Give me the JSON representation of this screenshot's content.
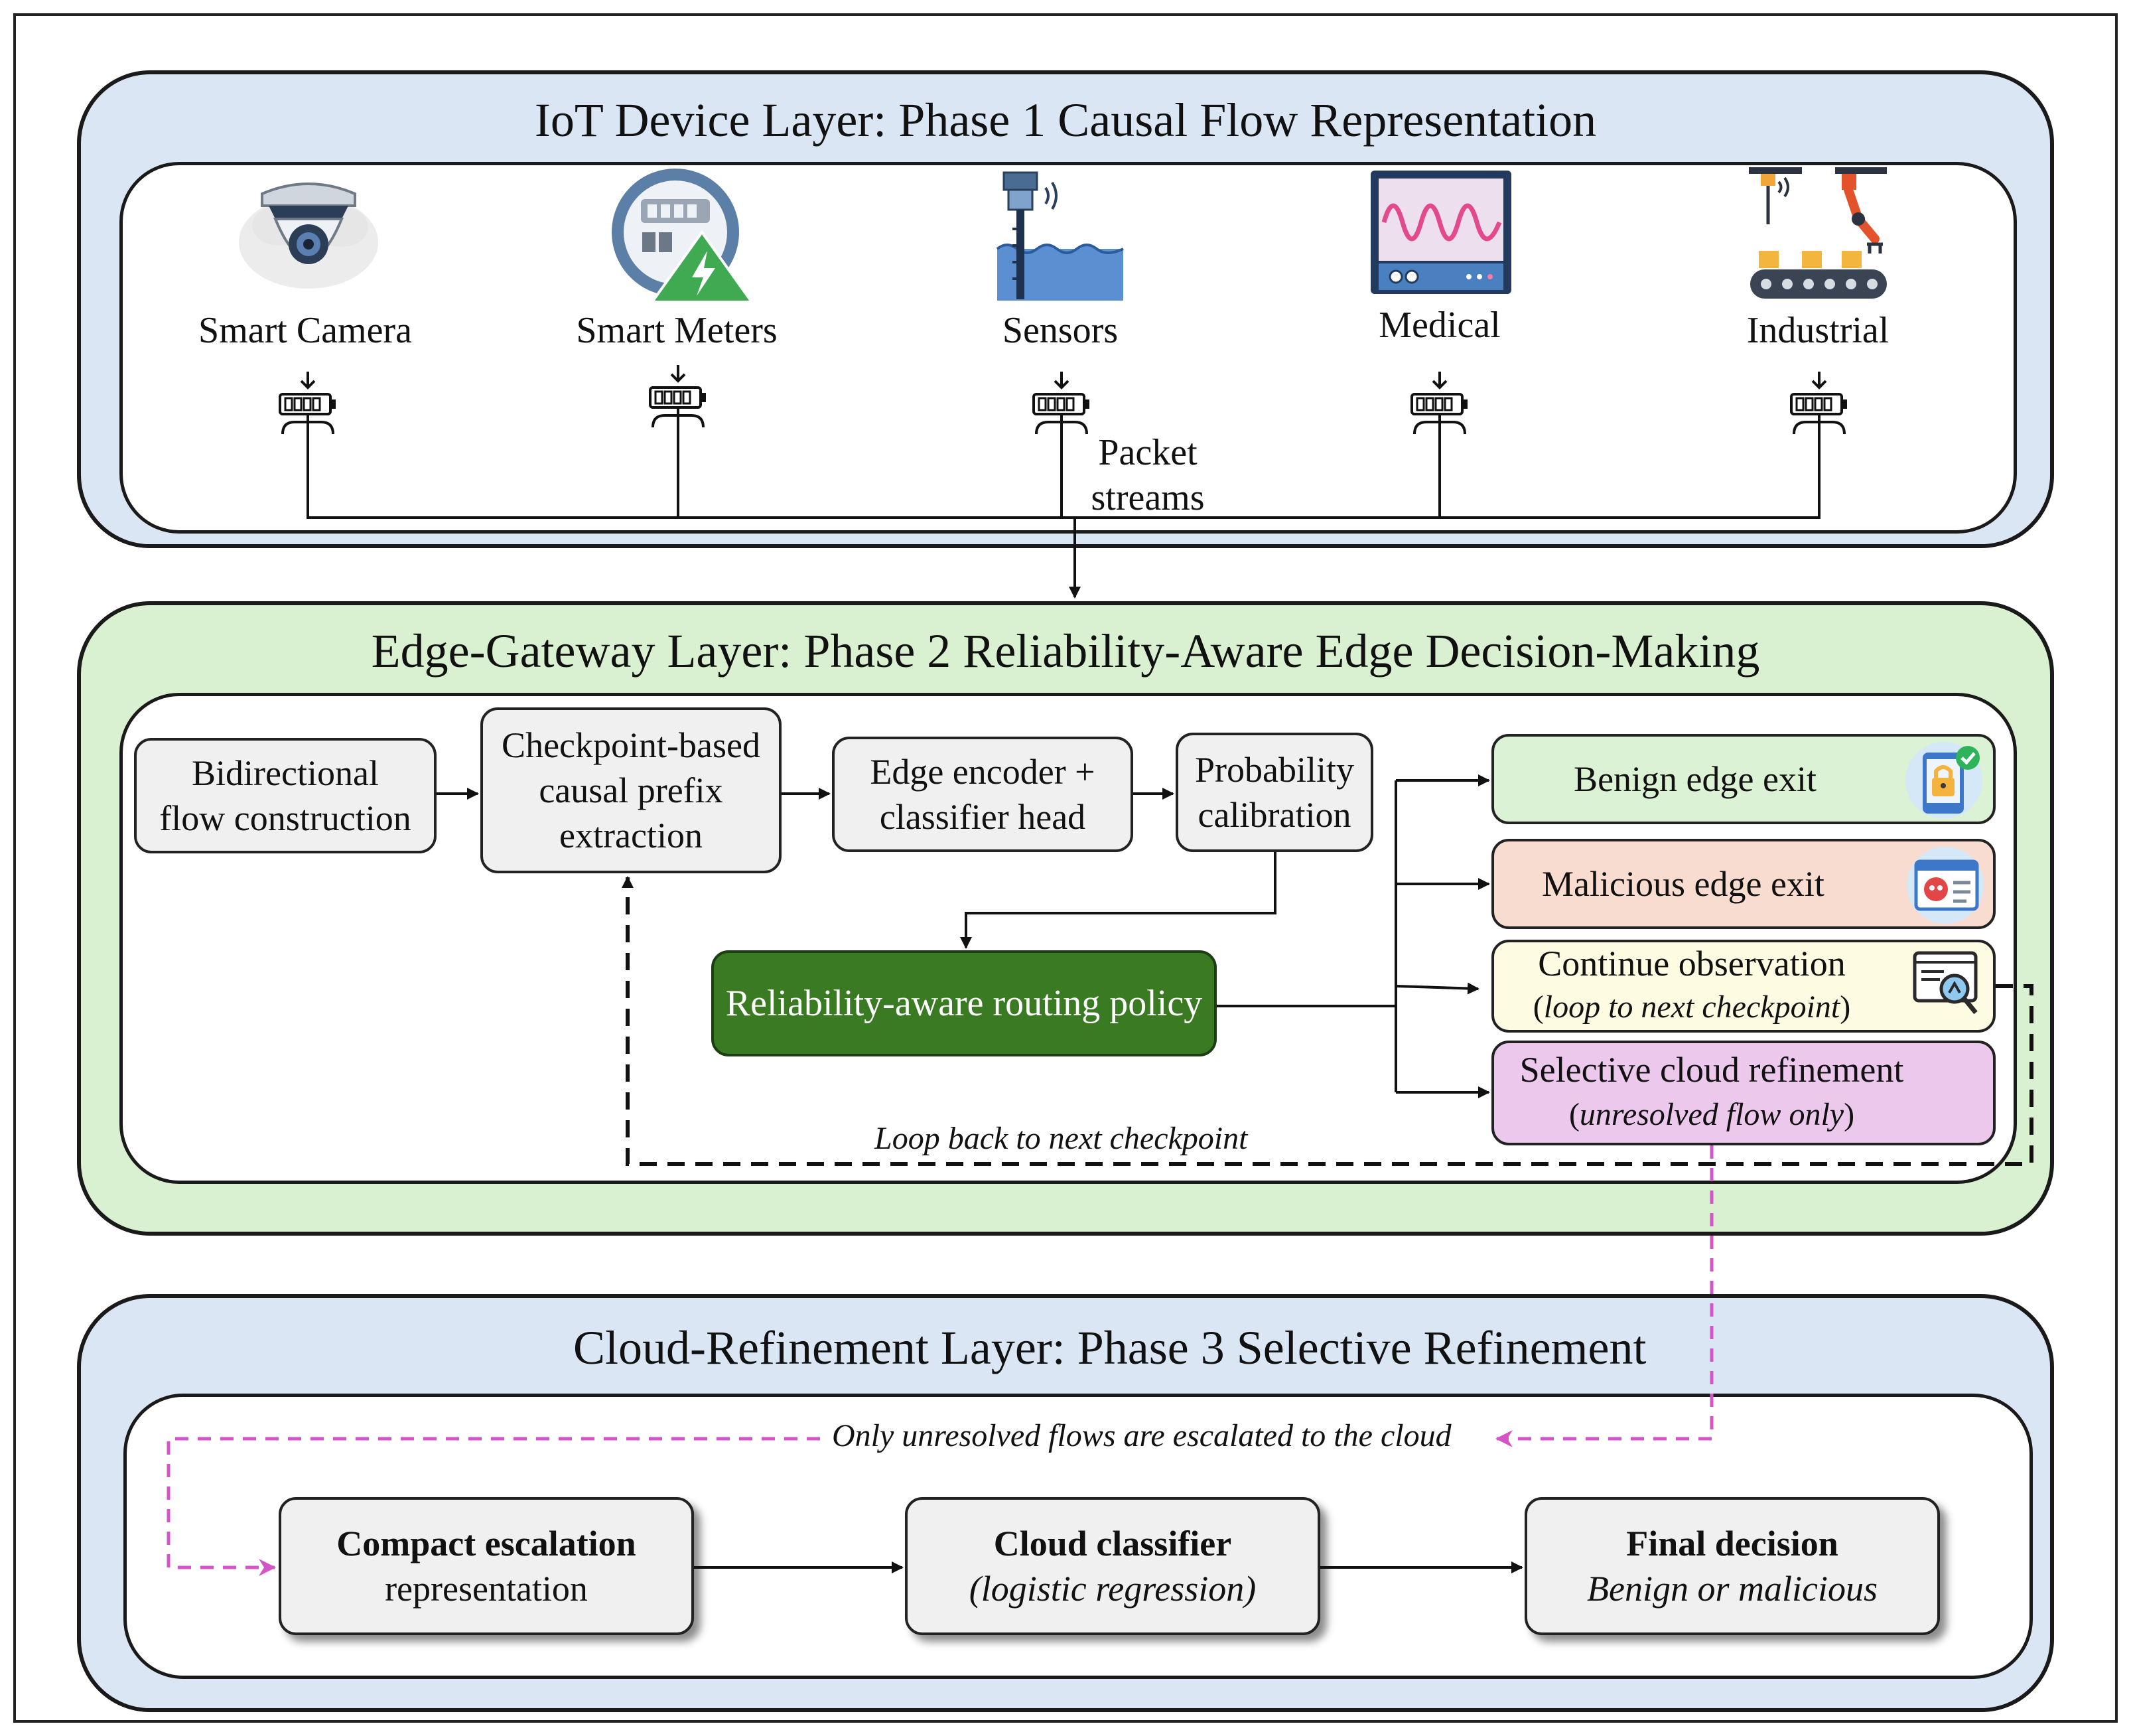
{
  "layer1": {
    "title": "IoT Device Layer: Phase 1 Causal Flow Representation",
    "devices": [
      {
        "label": "Smart Camera",
        "icon": "smart-camera-icon"
      },
      {
        "label": "Smart Meters",
        "icon": "smart-meter-icon"
      },
      {
        "label": "Sensors",
        "icon": "water-level-sensor-icon"
      },
      {
        "label": "Medical",
        "icon": "medical-monitor-icon"
      },
      {
        "label": "Industrial",
        "icon": "industrial-robot-arm-icon"
      }
    ],
    "stream_label_1": "Packet",
    "stream_label_2": "streams"
  },
  "layer2": {
    "title": "Edge-Gateway Layer: Phase 2 Reliability-Aware Edge Decision-Making",
    "step1": {
      "line1": "Bidirectional",
      "line2": "flow construction"
    },
    "step2": {
      "line1": "Checkpoint-based",
      "line2": "causal prefix",
      "line3": "extraction"
    },
    "step3": {
      "line1": "Edge encoder +",
      "line2": "classifier head"
    },
    "step4": {
      "line1": "Probability",
      "line2": "calibration"
    },
    "routing": "Reliability-aware routing policy",
    "outcomes": {
      "benign": "Benign edge exit",
      "malicious": "Malicious edge exit",
      "continue": "Continue observation",
      "continue_sub_open": "(",
      "continue_sub": "loop to next checkpoint",
      "continue_sub_close": ")",
      "cloud": "Selective cloud refinement",
      "cloud_sub": "unresolved flow only"
    },
    "loop_label": "Loop back to next checkpoint"
  },
  "layer3": {
    "title": "Cloud-Refinement Layer: Phase 3 Selective Refinement",
    "escalation_note": "Only unresolved flows are escalated to the cloud",
    "box1": {
      "line1": "Compact escalation",
      "line2": "representation"
    },
    "box2": {
      "line1": "Cloud classifier",
      "line2": "(logistic regression)"
    },
    "box3": {
      "line1": "Final decision",
      "line2": "Benign or malicious"
    }
  },
  "colors": {
    "layer_blue": "#dbe6f4",
    "layer_green": "#d9f1d0",
    "routing_green": "#3a7a23",
    "escalation_pink": "#d455c8",
    "benign": "#dcf2d4",
    "malicious": "#f9dcd0",
    "continue": "#fdfbe1",
    "cloud": "#ecc8ec"
  }
}
